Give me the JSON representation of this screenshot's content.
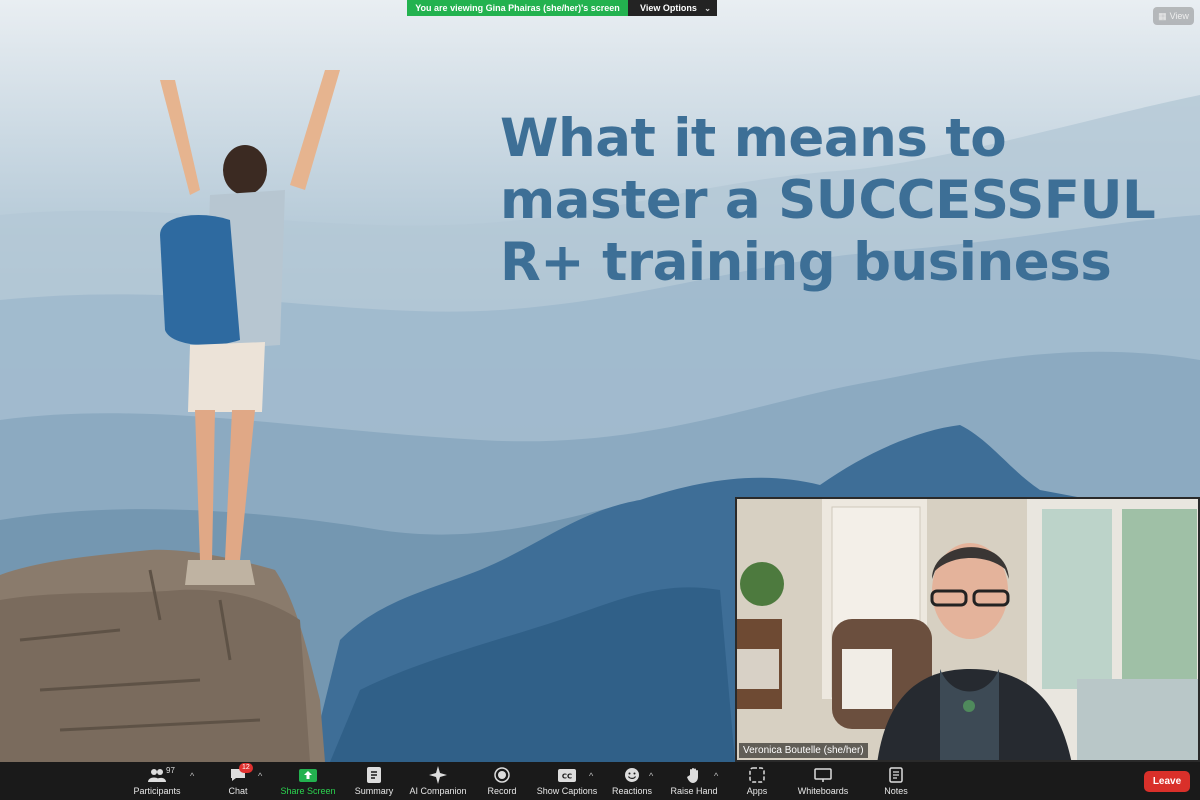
{
  "banner": {
    "viewing_text": "You are viewing Gina Phairas (she/her)'s screen",
    "view_options_label": "View Options"
  },
  "view_button_label": "View",
  "slide": {
    "title_lines": [
      "What it means to",
      "master a SUCCESSFUL",
      "R+ training business"
    ]
  },
  "self_view": {
    "name": "Veronica Boutelle (she/her)"
  },
  "toolbar": {
    "participants": {
      "label": "Participants",
      "count": "97"
    },
    "chat": {
      "label": "Chat",
      "badge": "12"
    },
    "share_screen": {
      "label": "Share Screen"
    },
    "summary": {
      "label": "Summary"
    },
    "ai_companion": {
      "label": "AI Companion"
    },
    "record": {
      "label": "Record"
    },
    "show_captions": {
      "label": "Show Captions"
    },
    "reactions": {
      "label": "Reactions"
    },
    "raise_hand": {
      "label": "Raise Hand"
    },
    "apps": {
      "label": "Apps"
    },
    "whiteboards": {
      "label": "Whiteboards"
    },
    "notes": {
      "label": "Notes"
    },
    "leave": {
      "label": "Leave"
    }
  },
  "colors": {
    "share_green": "#23b24f",
    "leave_red": "#d9302a",
    "title_blue": "#3d6f96",
    "toolbar_bg": "#1a1a1a"
  }
}
